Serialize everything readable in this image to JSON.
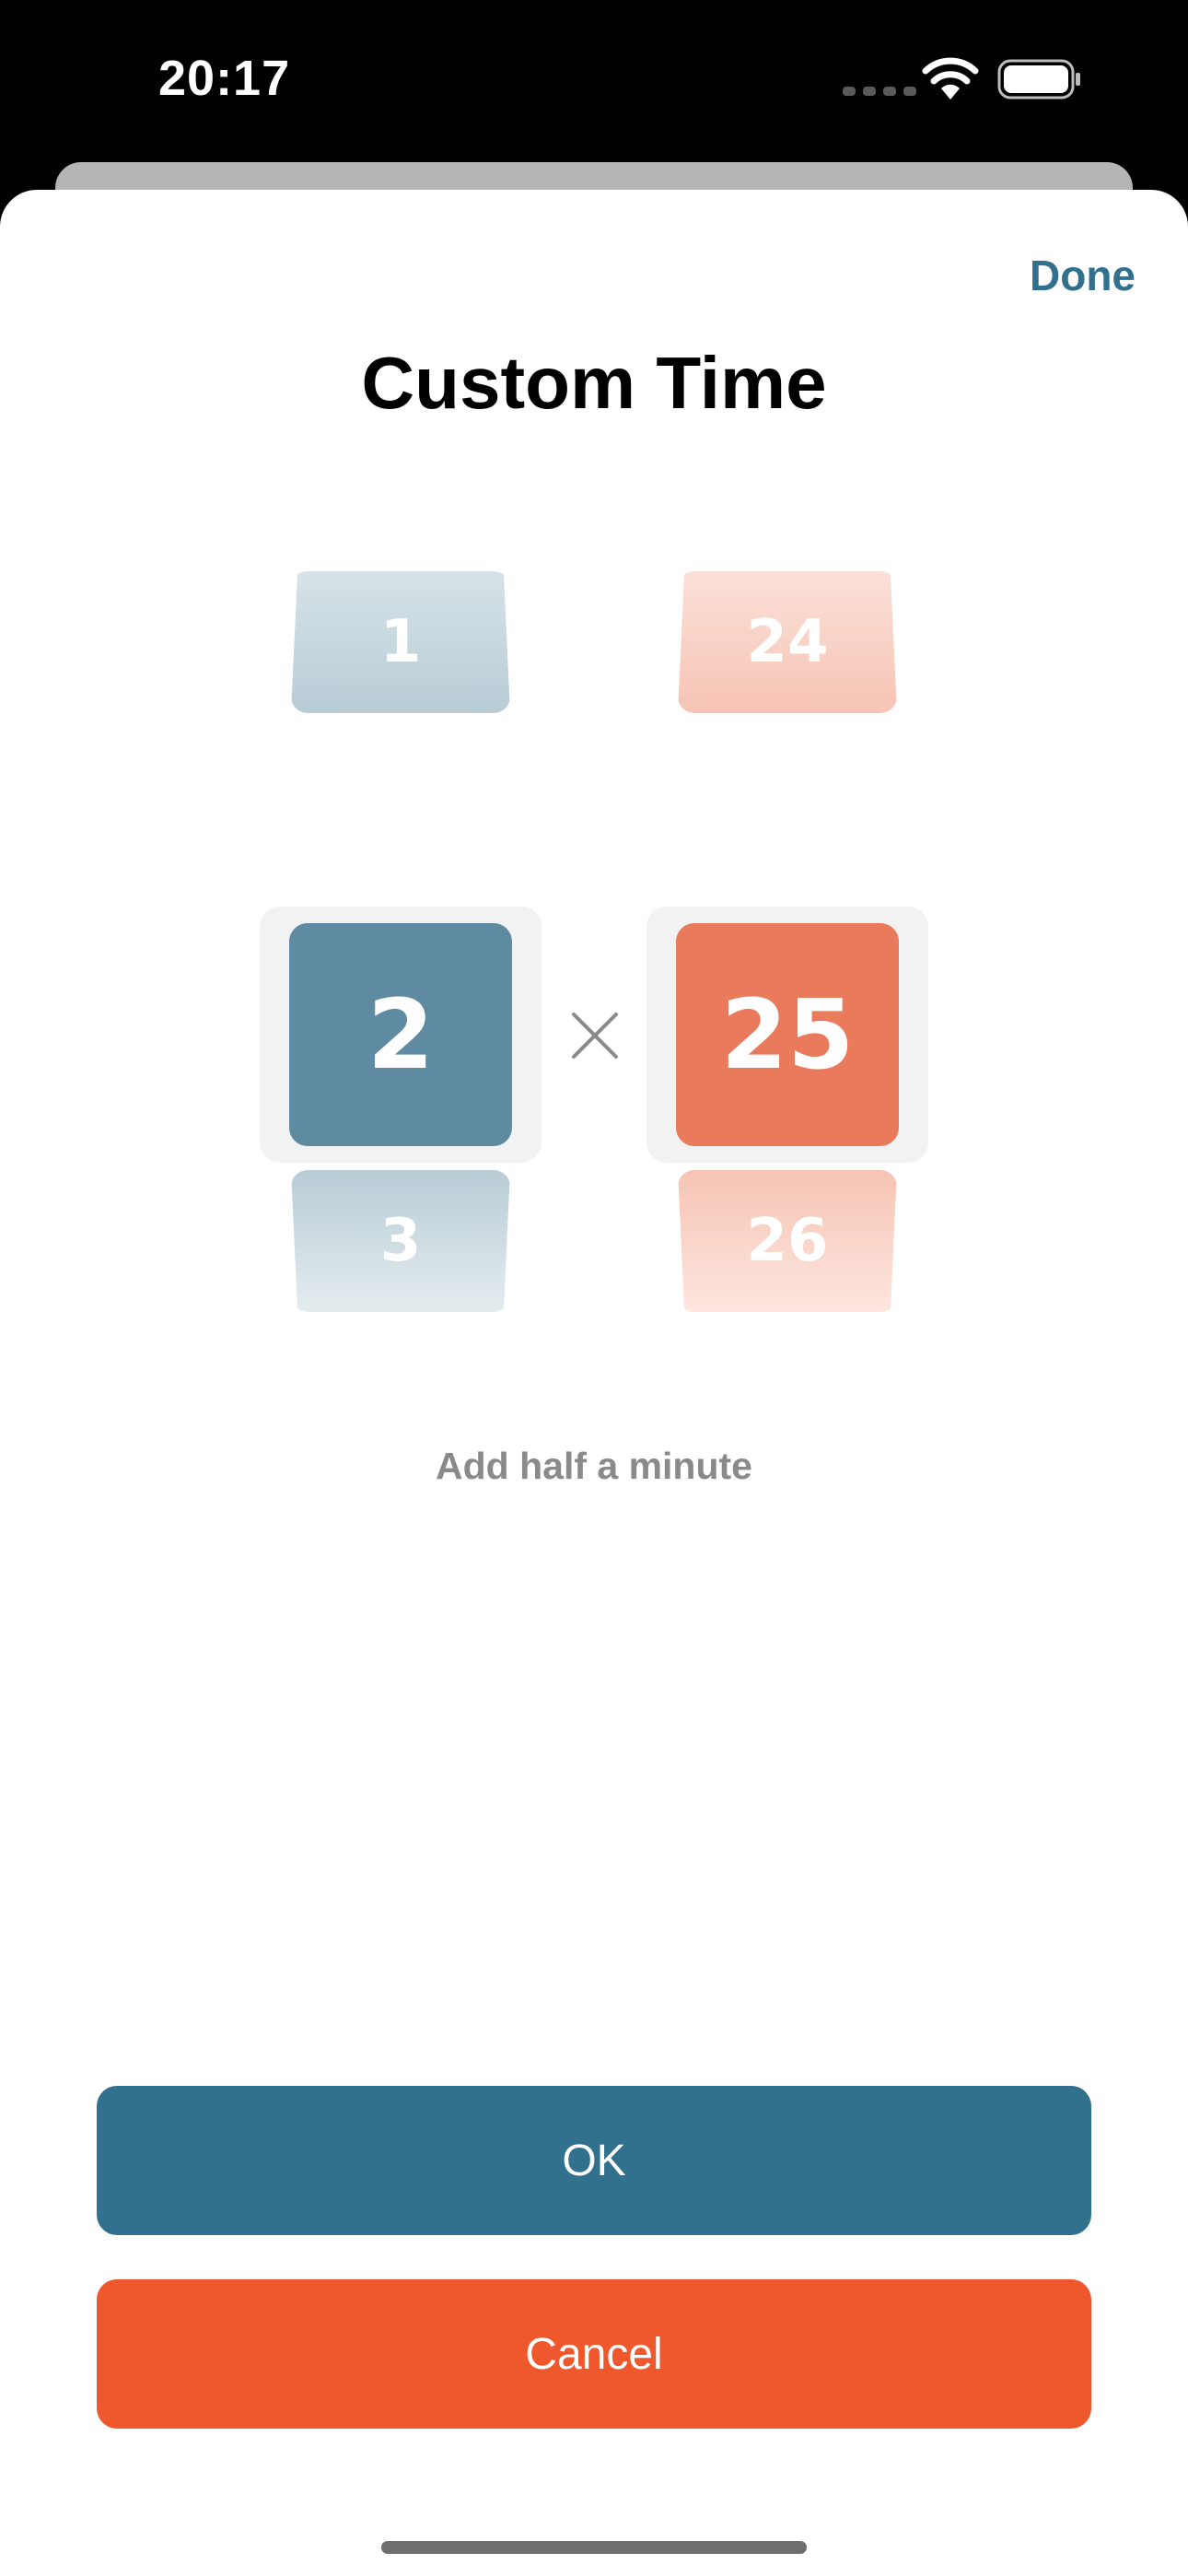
{
  "status_bar": {
    "time": "20:17"
  },
  "sheet": {
    "done_label": "Done",
    "title": "Custom Time"
  },
  "picker": {
    "left": {
      "prev": "1",
      "current": "2",
      "next": "3"
    },
    "right": {
      "prev": "24",
      "current": "25",
      "next": "26"
    },
    "operator_icon": "times-icon"
  },
  "helper_text": "Add half a minute",
  "buttons": {
    "ok": "OK",
    "cancel": "Cancel"
  },
  "colors": {
    "accent_blue": "#31718e",
    "accent_orange": "#ef582d",
    "left_tile": "#5e8aa2",
    "right_tile": "#e97a5c"
  }
}
